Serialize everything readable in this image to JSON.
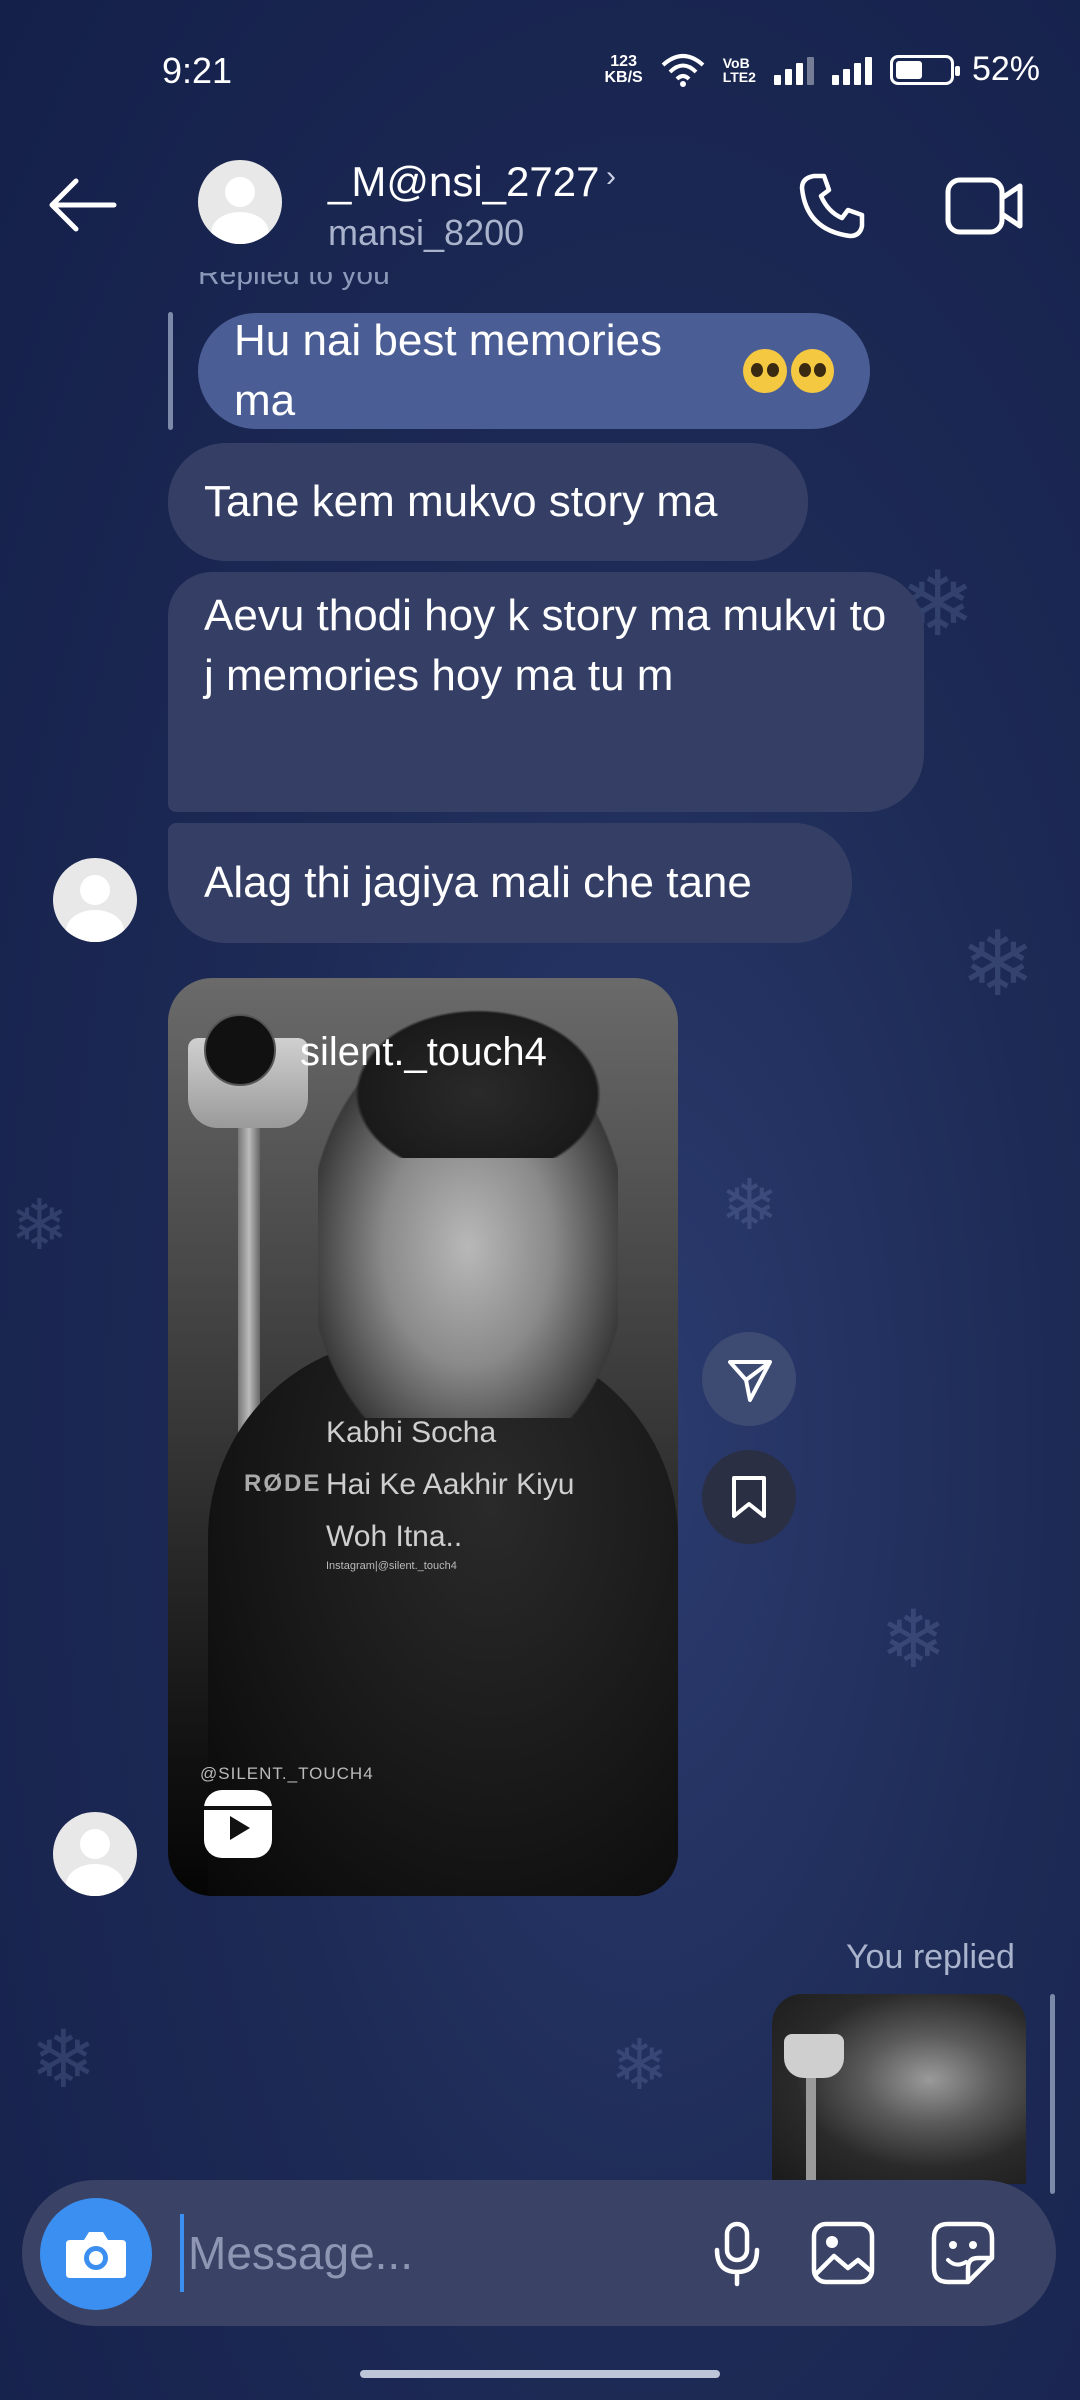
{
  "status_bar": {
    "time": "9:21",
    "net_speed_top": "123",
    "net_speed_bottom": "KB/S",
    "volte_top": "VoB",
    "volte_bottom": "LTE2",
    "battery": "52%"
  },
  "header": {
    "name": "_M@nsi_2727",
    "username": "mansi_8200",
    "chevron": "›"
  },
  "messages": {
    "replied_to_you_label": "Replied to you",
    "reply_quote": "Hu nai best memories ma",
    "incoming": [
      "Tane kem mukvo story ma",
      "Aevu thodi hoy k story ma mukvi to j memories hoy ma tu m",
      "Alag thi jagiya mali che tane"
    ]
  },
  "shared_reel": {
    "username": "silent._touch4",
    "caption_lines": [
      "Kabhi Socha",
      "Hai Ke Aakhir Kiyu",
      "Woh Itna.."
    ],
    "small_credit": "Instagram|@silent._touch4",
    "brand_text": "RØDE",
    "watermark": "@SILENT._TOUCH4"
  },
  "you_replied_label": "You replied",
  "composer": {
    "placeholder": "Message..."
  },
  "colors": {
    "accent": "#3b8ff0",
    "incoming_bubble": "#353f66",
    "reply_bubble": "#4b5d95"
  },
  "icons": [
    "back-arrow-icon",
    "phone-icon",
    "video-call-icon",
    "send-icon",
    "bookmark-icon",
    "camera-icon",
    "mic-icon",
    "gallery-icon",
    "sticker-icon",
    "reels-icon"
  ]
}
